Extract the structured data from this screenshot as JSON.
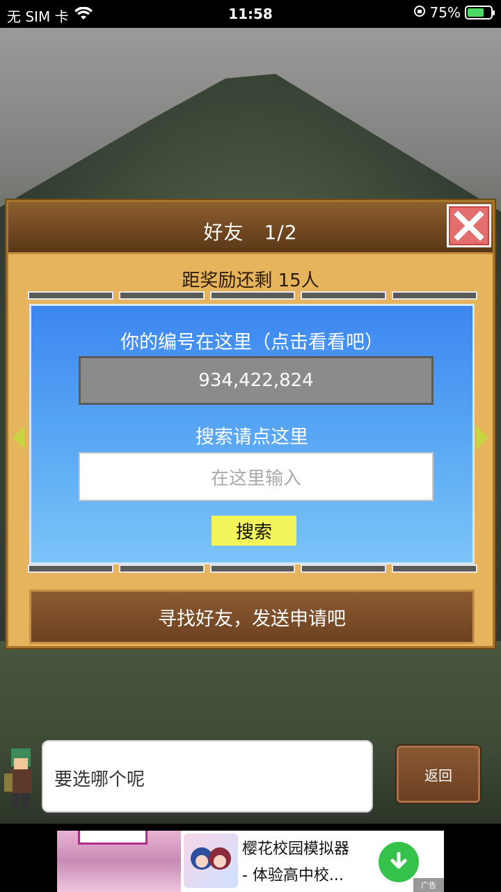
{
  "status_bar": {
    "carrier": "无 SIM 卡",
    "time": "11:58",
    "battery_percent": "75%",
    "battery_level": 0.75
  },
  "dialog": {
    "title": "好友　1/2",
    "reward_text": "距奖励还剩 15人",
    "id_label": "你的编号在这里（点击看看吧）",
    "id_value": "934,422,824",
    "search_label": "搜索请点这里",
    "search_placeholder": "在这里输入",
    "search_button": "搜索",
    "find_friends_button": "寻找好友，发送申请吧"
  },
  "chat": {
    "message": "要选哪个呢",
    "back_button": "返回"
  },
  "ad": {
    "title": "樱花校园模拟器",
    "subtitle": "- 体验高中校...",
    "mark": "广告"
  },
  "colors": {
    "dialog_frame": "#e5b45c",
    "header_brown": "#6e4620",
    "panel_blue": "#58a6f4",
    "search_button": "#f2f45a",
    "close_button": "#e46d6d",
    "download_green": "#35c24b"
  },
  "icons": [
    "wifi-icon",
    "orientation-lock-icon",
    "battery-icon",
    "close-icon",
    "left-arrow-icon",
    "right-arrow-icon",
    "download-icon"
  ]
}
